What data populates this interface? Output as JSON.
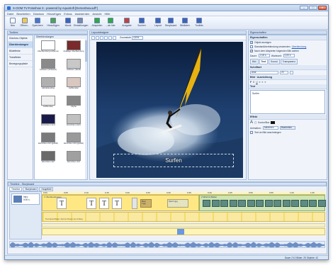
{
  "window": {
    "title": "X-OOM TV-Fotoshow 3 - powered by AquaSoft [Demoshow.adf*]"
  },
  "menu": [
    "Datei",
    "Bearbeiten",
    "Diashow",
    "Hinzufügen",
    "Extras",
    "Assistenten",
    "Ansicht",
    "Hilfe"
  ],
  "toolbar": [
    {
      "label": "Neu",
      "icon": "new-document-icon",
      "color": "#ffffff"
    },
    {
      "label": "Öffnen...",
      "icon": "open-folder-icon",
      "color": "#f2c94c"
    },
    {
      "label": "Speichern",
      "icon": "save-disk-icon",
      "color": "#4b74c9"
    },
    {
      "label": "Hinzufügen",
      "icon": "add-files-icon",
      "color": "#4fa34f"
    },
    {
      "label": "Musik",
      "icon": "music-note-icon",
      "color": "#3d63b8"
    },
    {
      "label": "Einstellungen",
      "icon": "settings-icon",
      "color": "#7a8aa8"
    },
    {
      "label": "Abspielen",
      "icon": "play-icon",
      "color": "#2eaa43"
    },
    {
      "label": "...ab hier",
      "icon": "play-from-here-icon",
      "color": "#2eaa43"
    },
    {
      "label": "Ausgabe",
      "icon": "output-icon",
      "color": "#c2423a"
    },
    {
      "label": "Suchen",
      "icon": "search-icon",
      "color": "#3d63b8"
    },
    {
      "label": "Layout",
      "icon": "layout-icon",
      "color": "#3d63b8"
    },
    {
      "label": "Storyboard",
      "icon": "storyboard-icon",
      "color": "#3d63b8"
    },
    {
      "label": "Bildlisten",
      "icon": "image-list-icon",
      "color": "#3d63b8"
    },
    {
      "label": "Toolbits",
      "icon": "toolbits-icon",
      "color": "#3d63b8"
    }
  ],
  "toolbox": {
    "header": "Toolbox",
    "nav": [
      "Diashow-Objekte",
      "Überblendungen",
      "Bildeffekte",
      "Textaffekte",
      "Bewegungspfade"
    ],
    "active_nav": "Überblendungen",
    "category": "Überblendungen",
    "items": [
      {
        "label": "Überblendung entfernen",
        "icon": "no-transition-icon"
      },
      {
        "label": "Zufällige Überblendung",
        "icon": "random-transition-icon"
      },
      {
        "label": "Auflösen (Schwarz)",
        "icon": "dissolve-black-icon"
      },
      {
        "label": "Auflösen (Weiß)",
        "icon": "dissolve-white-icon"
      },
      {
        "label": "Alphablending",
        "icon": "alphablending-icon"
      },
      {
        "label": "Aufblenden",
        "icon": "fade-in-icon"
      },
      {
        "label": "Aufblenden",
        "icon": "fade-in-icon"
      },
      {
        "label": "Cliphe",
        "icon": "clip-icon"
      },
      {
        "label": "Einrichten (1x1)",
        "icon": "grid-icon"
      },
      {
        "label": "Einrichten (2x2)",
        "icon": "grid-icon"
      },
      {
        "label": "Einrichten 2x2 (gefüllt)",
        "icon": "grid-icon"
      },
      {
        "label": "Einrichten 3x3 (gefüllt)",
        "icon": "grid-icon"
      },
      {
        "label": "Einrichten 4x2",
        "icon": "grid-icon"
      },
      {
        "label": "Einrichten 4x4",
        "icon": "grid-icon"
      }
    ]
  },
  "layoutdesigner": {
    "header": "Layoutdesigner",
    "zoom_label": "Zoomstufe",
    "zoom_value": "100%",
    "caption": "Surfen"
  },
  "properties": {
    "header": "Eigenschaften",
    "section_main": "Eigenschaften",
    "opt_show": "Objekt anzeigen",
    "opt_std_transition": "Standardüberblendung verwenden",
    "opt_std_link": "Überblendung",
    "opt_wait": "Nach dem Abspielen folgenden Bild warten",
    "duration_label": "Dauer:",
    "duration_value": "2,00 s",
    "wait_label": "Wartezeit:",
    "wait_value": "0,00 s",
    "tabs": [
      "Bild",
      "Text",
      "Sound",
      "Transparenz"
    ],
    "active_tab": "Text",
    "font_section": "Schriftart",
    "font_value": "Arial",
    "size_value": "20",
    "align_section": "Bild",
    "align_label": "Ausrichtung",
    "text_section": "Text",
    "text_value": "Surfen",
    "effects_section": "Effekt",
    "effect_label": "Kontur/Box",
    "animation_label": "Animation:",
    "animation_value": "Aktivieren",
    "edit_button": "Bearbeiten...",
    "text_fit": "Text an Bild anschmiegen"
  },
  "timeline": {
    "header": "Timeline - Storyboard",
    "tabs": [
      "Timeline",
      "Storyboard",
      "Hauptbild"
    ],
    "active_tab": "Timeline",
    "card_label": "Intro",
    "card_sub": "0:00 s",
    "track1_label": "1 Überblendungen",
    "track2_label": "2 Wind & Wellen",
    "thumb_labels": [
      "Meer 1.jpg",
      "Sport 4.jpg"
    ],
    "band_text": "Text-Sprechblase: Zeit bei Pausen am Anfang",
    "ruler": [
      "0:00",
      "0:05",
      "0:10",
      "0:15",
      "0:20",
      "0:25",
      "0:30",
      "0:35",
      "0:40",
      "0:45",
      "0:50",
      "0:55",
      "1:00",
      "1:05"
    ]
  },
  "status": {
    "text": "Dauer 2:10 Bilder: 25 Objekte: 42"
  }
}
